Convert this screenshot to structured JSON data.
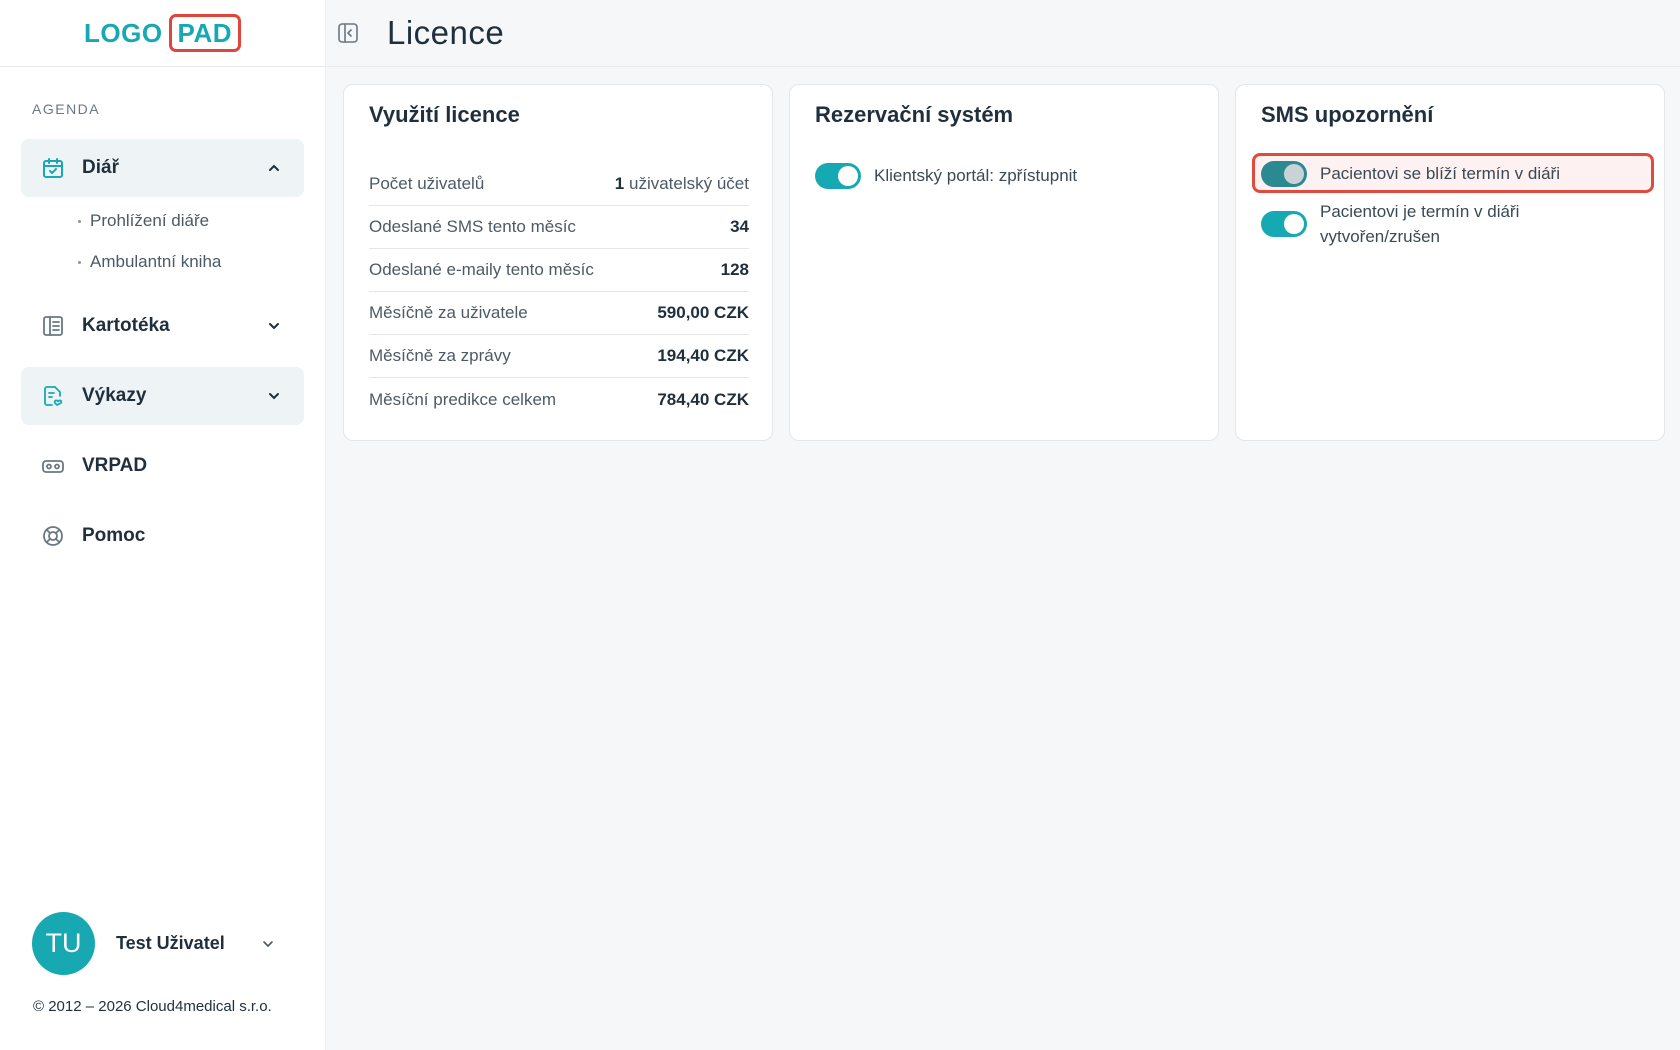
{
  "logo": {
    "left": "LOGO",
    "right": "PAD"
  },
  "sidebar": {
    "section_label": "AGENDA",
    "items": [
      {
        "label": "Diář",
        "icon": "calendar-check-icon",
        "expanded": true
      },
      {
        "label": "Kartotéka",
        "icon": "file-cabinet-icon",
        "expanded": false
      },
      {
        "label": "Výkazy",
        "icon": "report-icon",
        "expanded": false
      },
      {
        "label": "VRPAD",
        "icon": "vr-headset-icon"
      },
      {
        "label": "Pomoc",
        "icon": "lifebuoy-icon"
      }
    ],
    "sub_items": [
      "Prohlížení diáře",
      "Ambulantní kniha"
    ]
  },
  "user": {
    "initials": "TU",
    "name": "Test Uživatel"
  },
  "copyright": "© 2012 – 2026 Cloud4medical s.r.o.",
  "header": {
    "title": "Licence"
  },
  "license_card": {
    "title": "Využití licence",
    "rows": [
      {
        "key": "Počet uživatelů",
        "value_bold": "1",
        "value_light": " uživatelský účet"
      },
      {
        "key": "Odeslané SMS tento měsíc",
        "value": "34"
      },
      {
        "key": "Odeslané e-maily tento měsíc",
        "value": "128"
      },
      {
        "key": "Měsíčně za uživatele",
        "value": "590,00 CZK"
      },
      {
        "key": "Měsíčně za zprávy",
        "value": "194,40 CZK"
      },
      {
        "key": "Měsíční predikce celkem",
        "value": "784,40 CZK"
      }
    ]
  },
  "booking_card": {
    "title": "Rezervační systém",
    "toggles": [
      {
        "label": "Klientský portál: zpřístupnit",
        "on": true
      }
    ]
  },
  "sms_card": {
    "title": "SMS upozornění",
    "toggles": [
      {
        "label": "Pacientovi se blíží termín v diáři",
        "on": true
      },
      {
        "label": "Pacientovi je termín v diáři vytvořen/zrušen",
        "on": true
      }
    ]
  },
  "colors": {
    "accent": "#16a9b3",
    "highlight": "#e04b3f",
    "text": "#1f2f3d"
  }
}
